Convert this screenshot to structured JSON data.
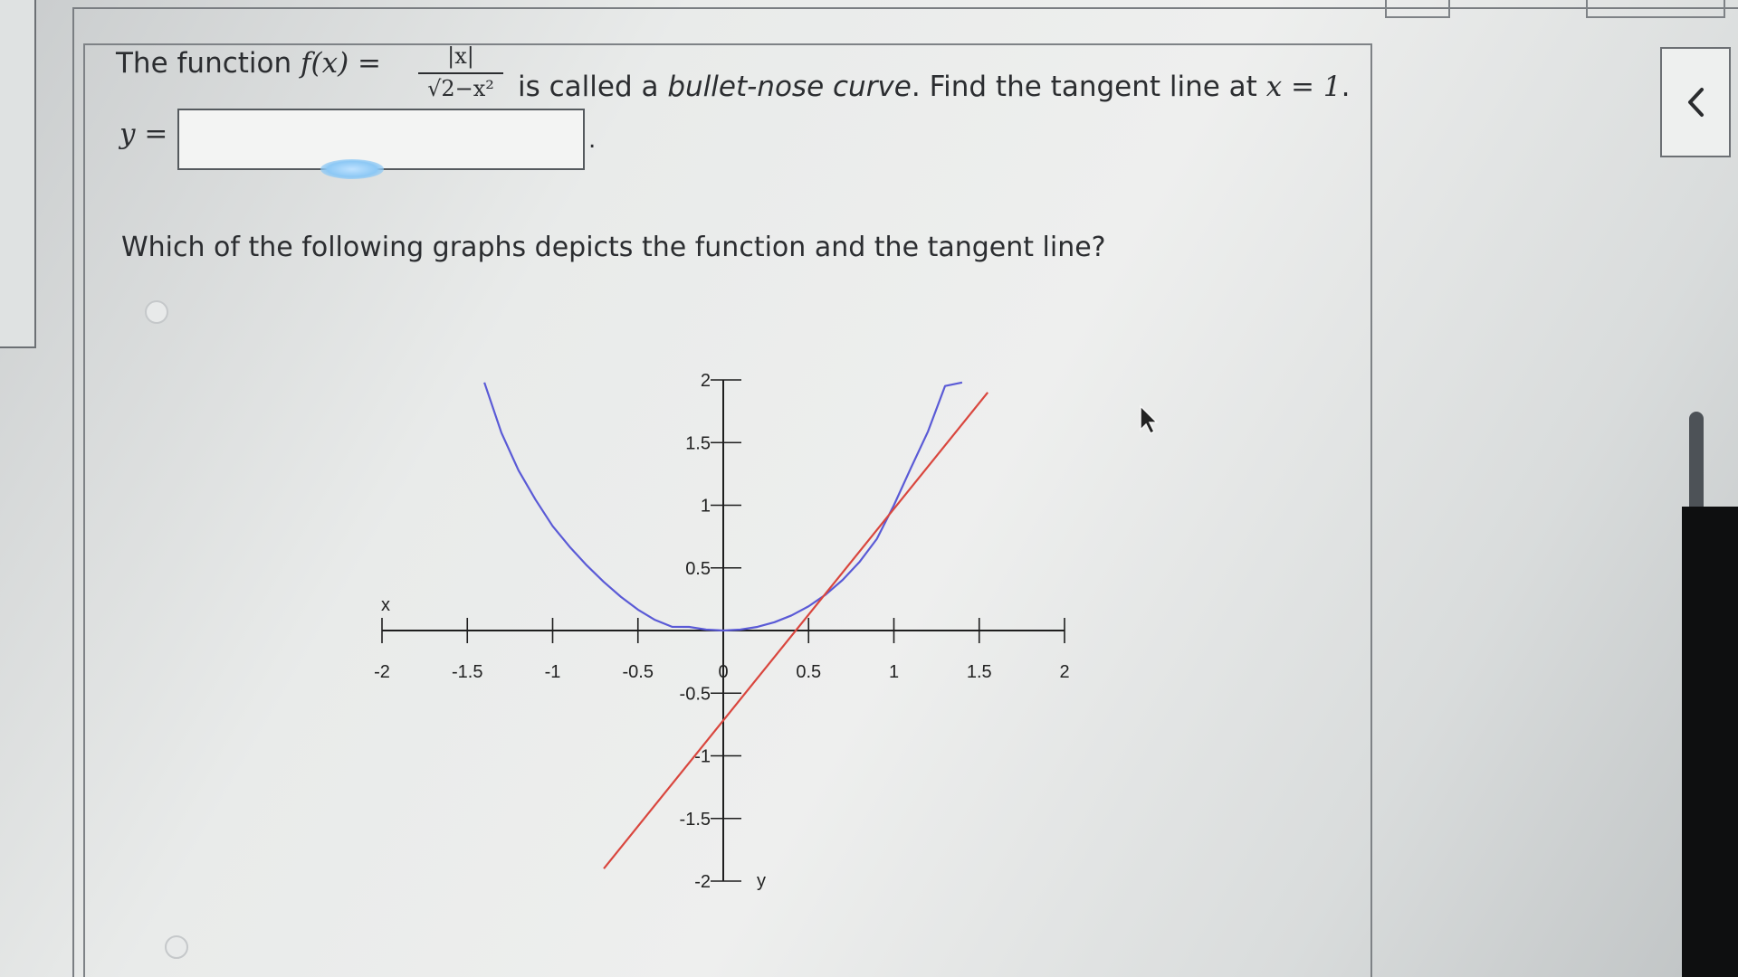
{
  "question": {
    "intro": "The function",
    "fx_label": "f(x)",
    "equals": "=",
    "numerator": "|x|",
    "denominator_root": "√",
    "denominator_body": "2−x²",
    "after_fraction": "is called a",
    "term": "bullet-nose curve",
    "task": ". Find the tangent line at",
    "at_x": "x = 1",
    "end": ".",
    "y_label": "y =",
    "answer_value": "",
    "answer_suffix": ".",
    "graph_question": "Which of the following graphs depicts the function and the tangent line?"
  },
  "options": [
    {
      "selected": false
    },
    {
      "selected": false
    }
  ],
  "chart_data": {
    "type": "line",
    "xlabel": "x",
    "ylabel": "y",
    "xlim": [
      -2,
      2
    ],
    "ylim": [
      -2,
      2
    ],
    "x_ticks": [
      "-2",
      "-1.5",
      "-1",
      "-0.5",
      "0",
      "0.5",
      "1",
      "1.5",
      "2"
    ],
    "y_ticks": [
      "2",
      "1.5",
      "1",
      "0.5",
      "0",
      "-0.5",
      "-1",
      "-1.5",
      "-2"
    ],
    "colors": {
      "function": "#5a5ad6",
      "tangent": "#d9463e",
      "axis": "#1e1e1e"
    },
    "series": [
      {
        "x": [
          -1.4,
          -1.3,
          -1.2,
          -1.1,
          -1.0,
          -0.9,
          -0.8,
          -0.7,
          -0.6,
          -0.5,
          -0.4,
          -0.3,
          -0.2,
          -0.1,
          0,
          0.1,
          0.2,
          0.3,
          0.4,
          0.5,
          0.6,
          0.7,
          0.8,
          0.9,
          1.0,
          1.1,
          1.2,
          1.3,
          1.4
        ],
        "y": [
          1.9798,
          1.5781,
          1.2783,
          1.0437,
          0.8333,
          0.6682,
          0.5201,
          0.3877,
          0.269,
          0.1667,
          0.0848,
          0.0295,
          0.029,
          0.0071,
          0,
          0.0071,
          0.029,
          0.0664,
          0.1206,
          0.1932,
          0.2867,
          0.4044,
          0.55,
          0.731,
          1.0,
          1.2981,
          1.5891,
          1.9519,
          1.9798
        ]
      },
      {
        "x": [
          -0.7,
          1.55
        ],
        "y": [
          -1.9,
          1.9
        ]
      }
    ]
  },
  "icons": {
    "back": "chevron-left-icon",
    "pointer": "mouse-pointer-icon"
  }
}
